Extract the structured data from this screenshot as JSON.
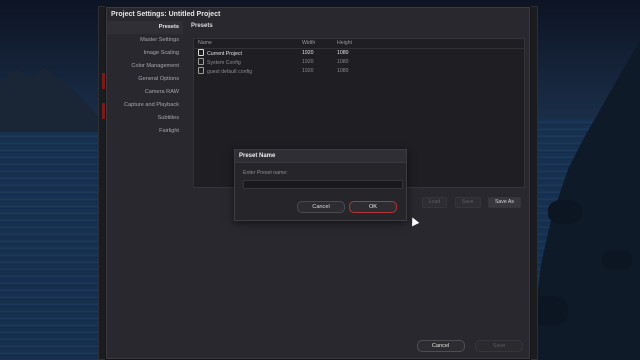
{
  "window": {
    "title": "Project Settings:  Untitled Project"
  },
  "sidebar": {
    "items": [
      {
        "label": "Presets",
        "active": true
      },
      {
        "label": "Master Settings"
      },
      {
        "label": "Image Scaling"
      },
      {
        "label": "Color Management"
      },
      {
        "label": "General Options"
      },
      {
        "label": "Camera RAW"
      },
      {
        "label": "Capture and Playback"
      },
      {
        "label": "Subtitles"
      },
      {
        "label": "Fairlight"
      }
    ]
  },
  "presets": {
    "heading": "Presets",
    "columns": {
      "name": "Name",
      "width": "Width",
      "height": "Height"
    },
    "rows": [
      {
        "name": "Current Project",
        "width": "1920",
        "height": "1080"
      },
      {
        "name": "System Config",
        "width": "1920",
        "height": "1080"
      },
      {
        "name": "guest default config",
        "width": "1920",
        "height": "1080"
      }
    ],
    "buttons": {
      "load": "Load",
      "save": "Save",
      "save_as": "Save As"
    }
  },
  "footer": {
    "cancel": "Cancel",
    "save": "Save"
  },
  "modal": {
    "title": "Preset Name",
    "label": "Enter Preset name:",
    "input_value": "",
    "cancel": "Cancel",
    "ok": "OK"
  },
  "colors": {
    "ok_border": "#b2353b"
  },
  "icons": [
    "document-icon",
    "mouse-cursor-icon"
  ]
}
